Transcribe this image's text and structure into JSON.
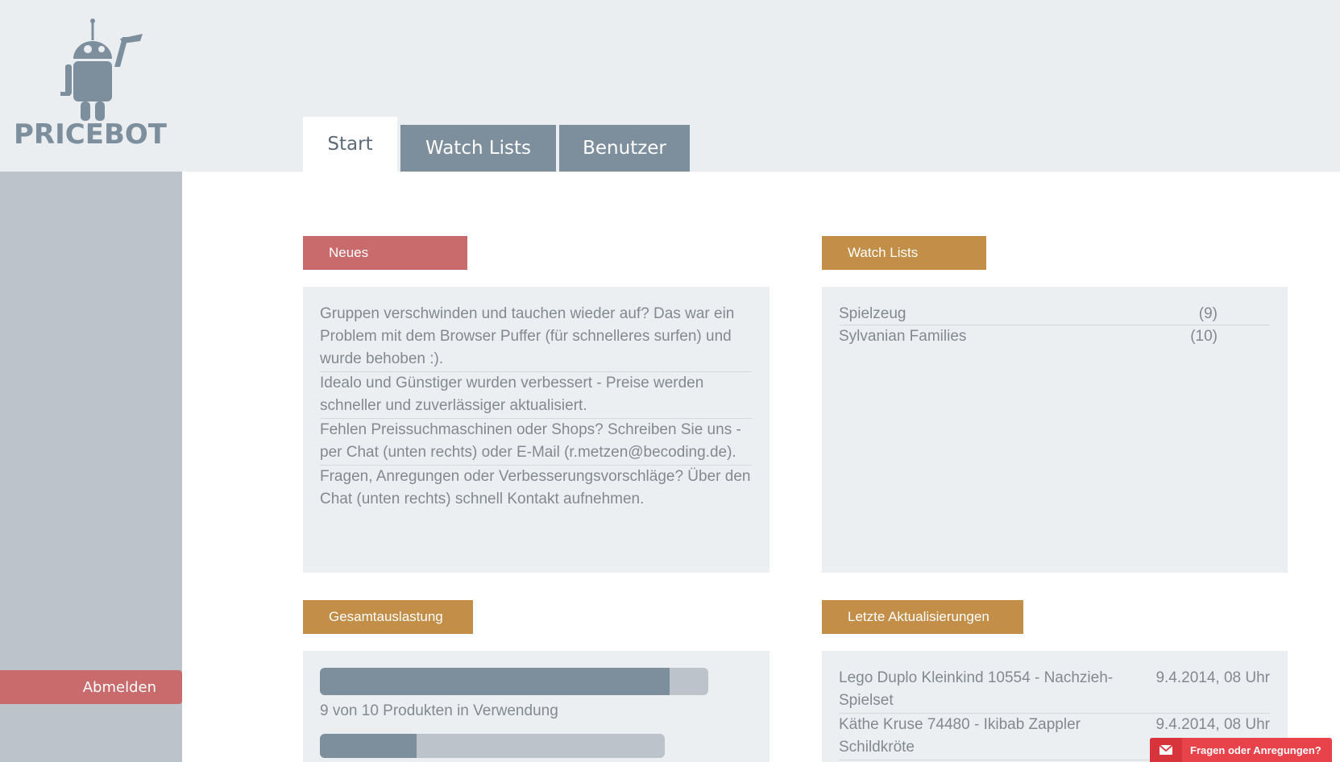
{
  "brand": {
    "logo_text": "PRICEBOT"
  },
  "tabs": [
    {
      "label": "Start",
      "active": true
    },
    {
      "label": "Watch Lists",
      "active": false
    },
    {
      "label": "Benutzer",
      "active": false
    }
  ],
  "sidebar": {
    "logout_label": "Abmelden"
  },
  "news": {
    "title": "Neues",
    "items": [
      "Gruppen verschwinden und tauchen wieder auf? Das war ein Problem mit dem Browser Puffer (für schnelleres surfen) und wurde behoben :).",
      "Idealo und Günstiger wurden verbessert - Preise werden schneller und zuverlässiger aktualisiert.",
      "Fehlen Preissuchmaschinen oder Shops? Schreiben Sie uns - per Chat (unten rechts) oder E-Mail (r.metzen@becoding.de).",
      "Fragen, Anregungen oder Verbesserungsvorschläge? Über den Chat (unten rechts) schnell Kontakt aufnehmen."
    ]
  },
  "watchlists": {
    "title": "Watch Lists",
    "items": [
      {
        "name": "Spielzeug",
        "count": "(9)"
      },
      {
        "name": "Sylvanian Families",
        "count": "(10)"
      }
    ]
  },
  "usage": {
    "title": "Gesamtauslastung",
    "products_text": "9 von 10 Produkten in Verwendung",
    "products_fraction": 0.9,
    "second_fraction": 0.28
  },
  "updates": {
    "title": "Letzte Aktualisierungen",
    "items": [
      {
        "name": "Lego Duplo Kleinkind 10554 - Nachzieh-Spielset",
        "date": "9.4.2014, 08 Uhr"
      },
      {
        "name": "Käthe Kruse 74480 - Ikibab Zappler Schildkröte",
        "date": "9.4.2014, 08 Uhr"
      }
    ]
  },
  "chat": {
    "label": "Fragen oder Anregungen?",
    "icon": "envelope-icon"
  },
  "colors": {
    "header_bg": "#eaeef1",
    "sidebar_bg": "#bcc3cb",
    "tab_bg": "#7d8e9c",
    "accent_red": "#c96b6d",
    "accent_orange": "#c38e47",
    "panel_bg": "#eceff2",
    "chat_red": "#e8424a"
  }
}
